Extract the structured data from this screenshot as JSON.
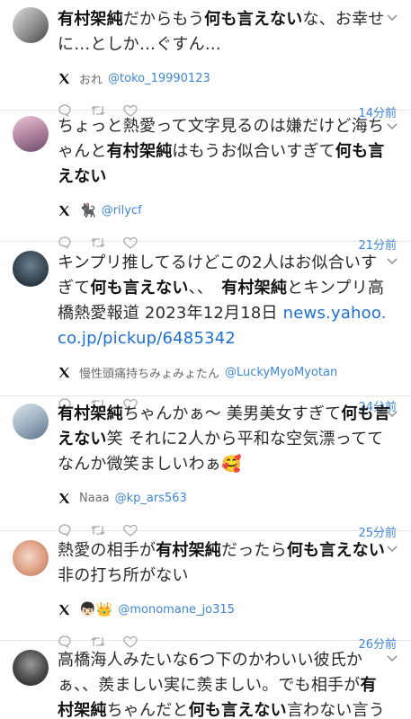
{
  "tweets": [
    {
      "segments": [
        {
          "t": "有村架純",
          "b": true
        },
        {
          "t": "だからもう",
          "b": false
        },
        {
          "t": "何も言えない",
          "b": true
        },
        {
          "t": "な、お幸せに…としか…ぐすん…",
          "b": false
        }
      ],
      "display_name": "おれ",
      "handle": "@toko_19990123",
      "time": "14分前"
    },
    {
      "segments": [
        {
          "t": "ちょっと熱愛って文字見るのは嫌だけど海ちゃんと",
          "b": false
        },
        {
          "t": "有村架純",
          "b": true
        },
        {
          "t": "はもうお似合いすぎて",
          "b": false
        },
        {
          "t": "何も言えない",
          "b": true
        }
      ],
      "display_name": "🐈‍⬛",
      "handle": "@rilycf",
      "time": "21分前"
    },
    {
      "segments": [
        {
          "t": "キンプリ推してるけどこの2人はお似合いすぎて",
          "b": false
        },
        {
          "t": "何も言えない",
          "b": true
        },
        {
          "t": "、、　",
          "b": false
        },
        {
          "t": "有村架純",
          "b": true
        },
        {
          "t": "とキンプリ高橋熱愛報道 2023年12月18日 ",
          "b": false
        },
        {
          "t": "news.yahoo.co.jp/pickup/6485342",
          "b": false,
          "link": true
        }
      ],
      "display_name": "慢性頭痛持ちみょみょたん",
      "handle": "@LuckyMyoMyotan",
      "time": "24分前"
    },
    {
      "segments": [
        {
          "t": "有村架純",
          "b": true
        },
        {
          "t": "ちゃんかぁ〜 美男美女すぎて",
          "b": false
        },
        {
          "t": "何も言えない",
          "b": true
        },
        {
          "t": "笑 それに2人から平和な空気漂っててなんか微笑ましいわぁ🥰",
          "b": false
        }
      ],
      "display_name": "Naaa",
      "handle": "@kp_ars563",
      "time": "25分前"
    },
    {
      "segments": [
        {
          "t": "熱愛の相手が",
          "b": false
        },
        {
          "t": "有村架純",
          "b": true
        },
        {
          "t": "だったら",
          "b": false
        },
        {
          "t": "何も言えない",
          "b": true
        },
        {
          "t": "非の打ち所がない",
          "b": false
        }
      ],
      "display_name": "👦🏻👑",
      "handle": "@monomane_jo315",
      "time": "26分前"
    },
    {
      "segments": [
        {
          "t": "高橋海人みたいな6つ下のかわいい彼氏かぁ、、羨ましい実に羨ましい。でも相手が",
          "b": false
        },
        {
          "t": "有村架純",
          "b": true
        },
        {
          "t": "ちゃんだと",
          "b": false
        },
        {
          "t": "何も言えない",
          "b": true
        },
        {
          "t": "言わない言う",
          "b": false
        }
      ],
      "display_name": "",
      "handle": "",
      "time": ""
    }
  ],
  "colors": {
    "accent": "#3d86d8",
    "link": "#1d6fd1",
    "divider": "#e6e6e6"
  }
}
